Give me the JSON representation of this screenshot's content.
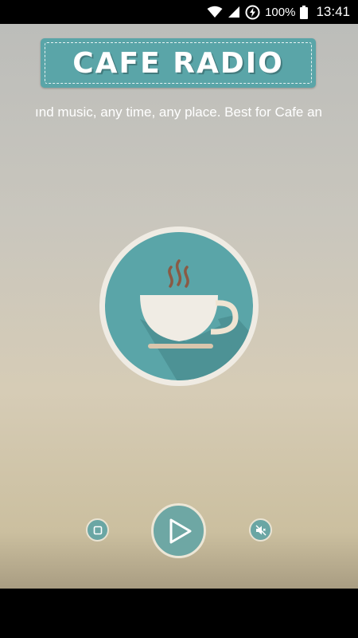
{
  "status_bar": {
    "battery_percent": "100%",
    "time": "13:41",
    "icons": [
      "wifi-icon",
      "cell-signal-icon",
      "data-saver-icon"
    ]
  },
  "app": {
    "logo_text": "CAFE RADIO",
    "marquee_text": "ınd music, any time, any place. Best for Cafe an",
    "badge_icon": "coffee-cup-icon"
  },
  "controls": {
    "stop_icon": "stop-icon",
    "play_icon": "play-icon",
    "mute_icon": "volume-mute-icon"
  },
  "colors": {
    "teal": "#5aa5a8",
    "cream": "#f0ece4",
    "steam": "#8a5a44"
  }
}
